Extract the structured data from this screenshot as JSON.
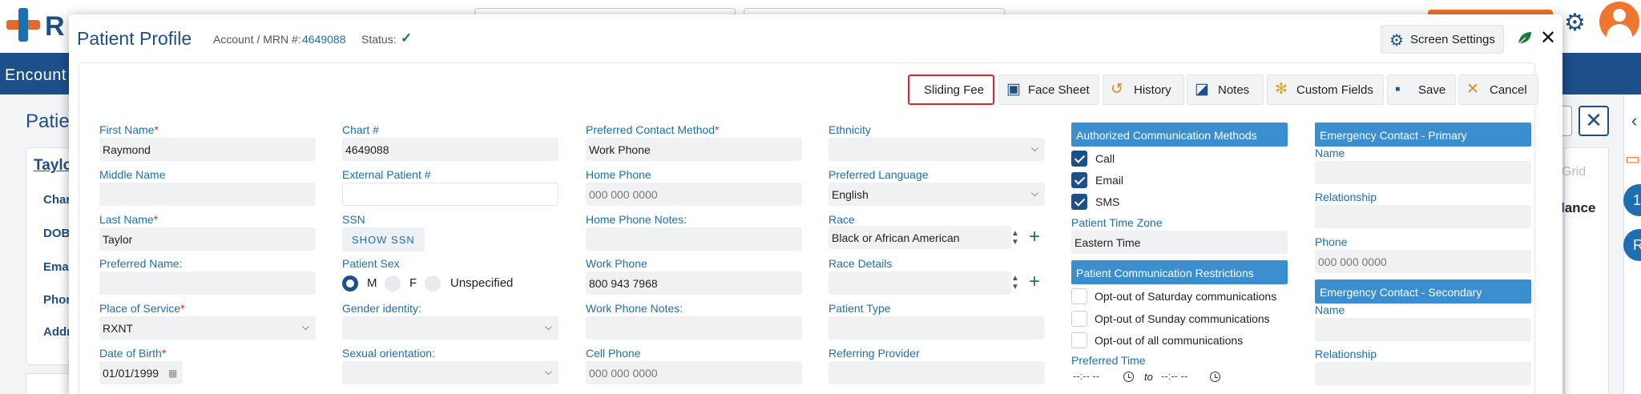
{
  "background": {
    "logo_text": "R",
    "nav_text": "Encount",
    "page_title": "Patie",
    "patient_link": "Taylo",
    "left_labels": [
      "Char",
      "DOB",
      "Emai",
      "Phon",
      "Addr"
    ],
    "grid_text": "t Grid",
    "balance_text": "lance",
    "close_glyph": "✕",
    "circles": [
      "1",
      "R"
    ]
  },
  "modal": {
    "title": "Patient Profile",
    "account_label": "Account / MRN #:",
    "account_value": "4649088",
    "status_label": "Status:",
    "status_icon": "check-icon",
    "screen_settings_label": "Screen Settings",
    "close_glyph": "✕"
  },
  "toolbar": {
    "sliding_fee": "Sliding Fee",
    "face_sheet": "Face Sheet",
    "history": "History",
    "notes": "Notes",
    "custom_fields": "Custom Fields",
    "save": "Save",
    "cancel": "Cancel"
  },
  "column1": {
    "first_name": {
      "label": "First Name",
      "value": "Raymond"
    },
    "middle_name": {
      "label": "Middle Name",
      "value": ""
    },
    "last_name": {
      "label": "Last Name",
      "value": "Taylor"
    },
    "preferred_name": {
      "label": "Preferred Name:",
      "value": ""
    },
    "place_of_service": {
      "label": "Place of Service",
      "value": "RXNT"
    },
    "date_of_birth": {
      "label": "Date of Birth",
      "value": "01/01/1999"
    }
  },
  "column2": {
    "chart": {
      "label": "Chart #",
      "value": "4649088"
    },
    "external_patient": {
      "label": "External Patient #",
      "value": ""
    },
    "ssn": {
      "label": "SSN",
      "button": "SHOW SSN"
    },
    "patient_sex": {
      "label": "Patient Sex",
      "options": [
        "M",
        "F",
        "Unspecified"
      ],
      "selected": "M"
    },
    "gender_identity": {
      "label": "Gender identity:",
      "value": ""
    },
    "sexual_orientation": {
      "label": "Sexual orientation:",
      "value": ""
    }
  },
  "column3": {
    "preferred_contact": {
      "label": "Preferred Contact Method",
      "value": "Work Phone"
    },
    "home_phone": {
      "label": "Home Phone",
      "placeholder": "000 000 0000"
    },
    "home_phone_notes": {
      "label": "Home Phone Notes:",
      "value": ""
    },
    "work_phone": {
      "label": "Work Phone",
      "value": "800 943 7968"
    },
    "work_phone_notes": {
      "label": "Work Phone Notes:",
      "value": ""
    },
    "cell_phone": {
      "label": "Cell Phone",
      "placeholder": "000 000 0000"
    }
  },
  "column4": {
    "ethnicity": {
      "label": "Ethnicity",
      "value": ""
    },
    "preferred_language": {
      "label": "Preferred Language",
      "value": "English"
    },
    "race": {
      "label": "Race",
      "value": "Black or African American"
    },
    "race_details": {
      "label": "Race Details",
      "value": ""
    },
    "patient_type": {
      "label": "Patient Type",
      "value": ""
    },
    "referring_provider": {
      "label": "Referring Provider",
      "value": ""
    }
  },
  "column5": {
    "auth_header": "Authorized Communication Methods",
    "auth_methods": [
      {
        "label": "Call",
        "checked": true
      },
      {
        "label": "Email",
        "checked": true
      },
      {
        "label": "SMS",
        "checked": true
      }
    ],
    "time_zone": {
      "label": "Patient Time Zone",
      "value": "Eastern Time"
    },
    "restrictions_header": "Patient Communication Restrictions",
    "restrictions": [
      {
        "label": "Opt-out of Saturday communications",
        "checked": false
      },
      {
        "label": "Opt-out of Sunday communications",
        "checked": false
      },
      {
        "label": "Opt-out of all communications",
        "checked": false
      }
    ],
    "preferred_time": {
      "label": "Preferred Time",
      "from": "--:-- --",
      "to_label": "to",
      "to": "--:-- --"
    }
  },
  "column6": {
    "primary_header": "Emergency Contact - Primary",
    "primary_name": {
      "label": "Name",
      "value": ""
    },
    "primary_relationship": {
      "label": "Relationship",
      "value": ""
    },
    "primary_phone": {
      "label": "Phone",
      "placeholder": "000 000 0000"
    },
    "secondary_header": "Emergency Contact - Secondary",
    "secondary_name": {
      "label": "Name",
      "value": ""
    },
    "secondary_relationship": {
      "label": "Relationship",
      "value": ""
    }
  },
  "colors": {
    "brand_blue": "#1d4f8a",
    "label_blue": "#1d6fb0",
    "section_blue": "#3b8fd0",
    "accent_orange": "#f0752e",
    "required_red": "#e0252b",
    "highlight_red": "#e0252b"
  }
}
